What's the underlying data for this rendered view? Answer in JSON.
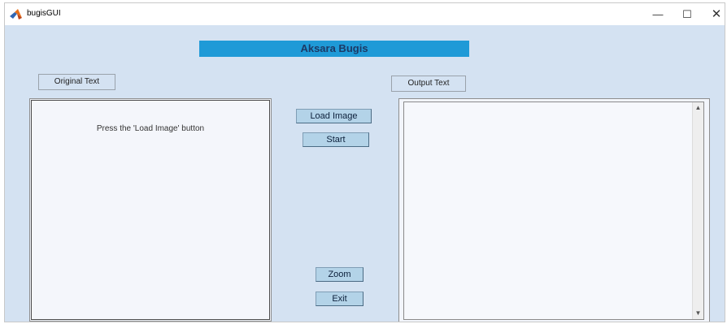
{
  "window": {
    "title": "bugisGUI",
    "minimize": "—",
    "maximize": "☐",
    "close": "✕",
    "icon": "matlab-icon"
  },
  "header": {
    "title": "Aksara Bugis",
    "color": "#1f9ad7"
  },
  "labels": {
    "original": "Original Text",
    "output": "Output Text"
  },
  "left_panel": {
    "hint": "Press the 'Load Image' button"
  },
  "buttons": {
    "load_image": "Load Image",
    "start": "Start",
    "zoom": "Zoom",
    "exit": "Exit"
  },
  "output": {
    "text": "",
    "scroll_up": "▲",
    "scroll_down": "▼"
  },
  "colors": {
    "background": "#d4e2f2",
    "button": "#b3d3e8"
  }
}
